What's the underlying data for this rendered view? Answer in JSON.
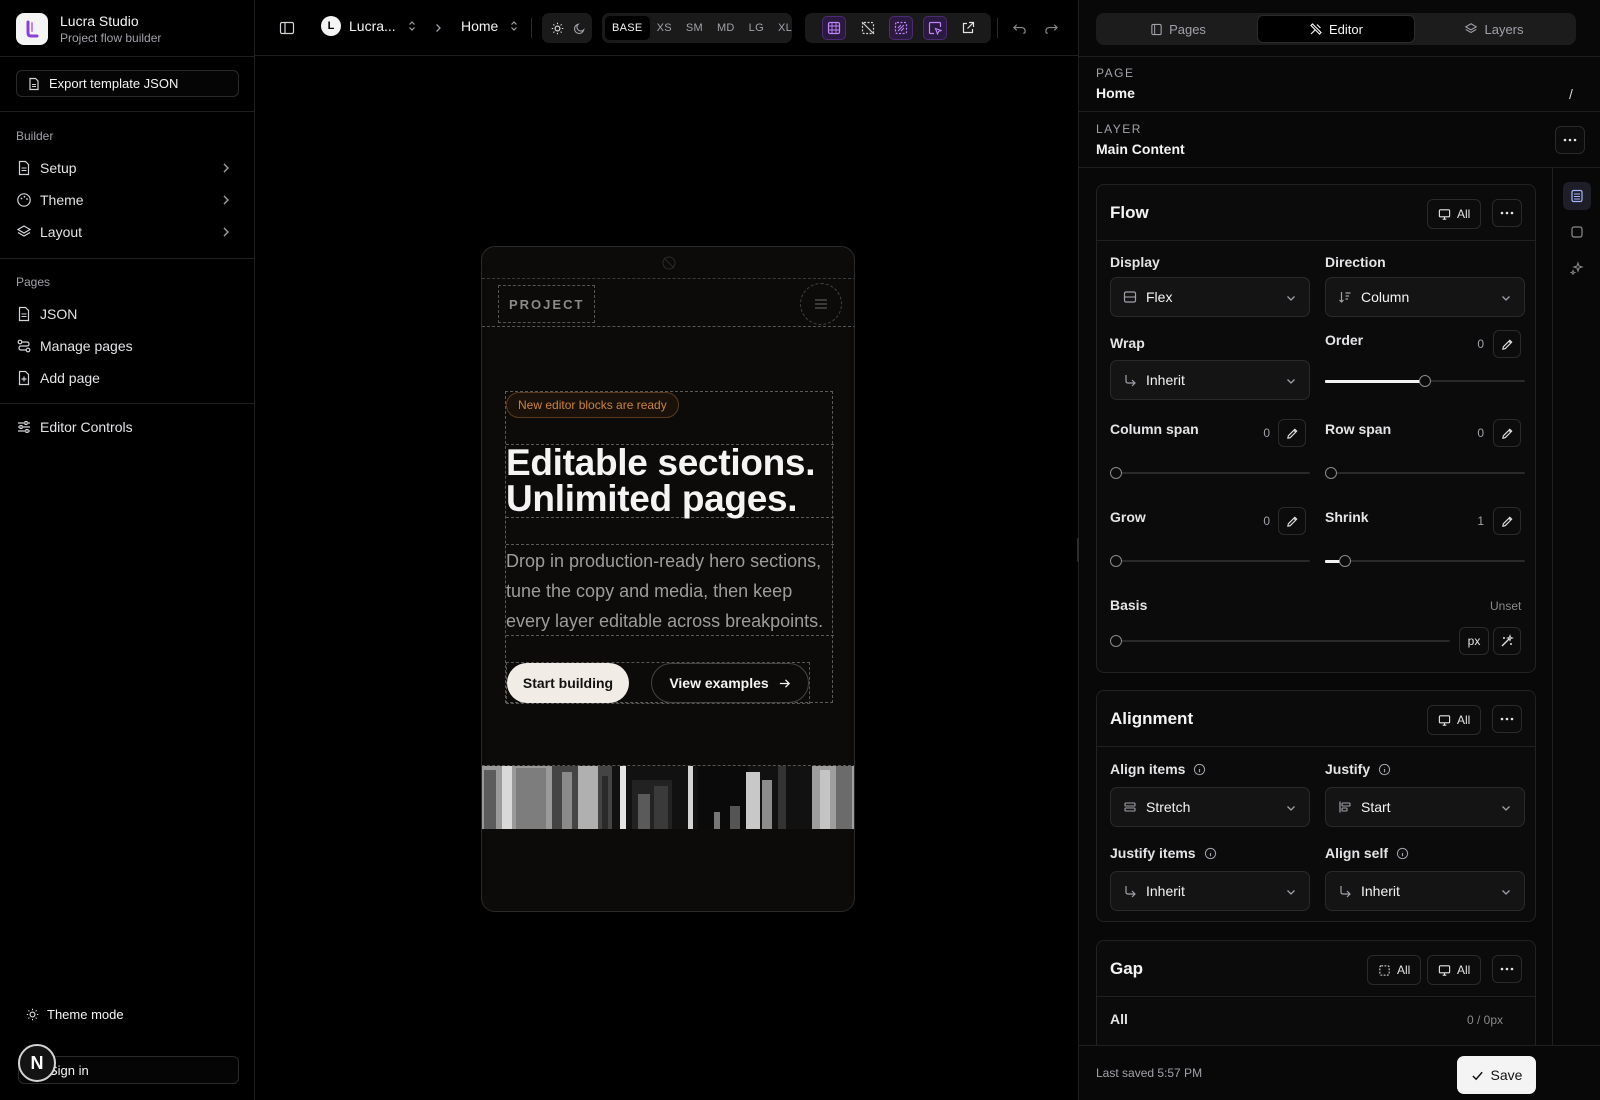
{
  "brand": {
    "name": "Lucra Studio",
    "subtitle": "Project flow builder"
  },
  "sidebar": {
    "export_label": "Export template JSON",
    "builder_label": "Builder",
    "builder_items": [
      {
        "label": "Setup",
        "icon": "document-icon"
      },
      {
        "label": "Theme",
        "icon": "palette-icon"
      },
      {
        "label": "Layout",
        "icon": "layers-icon"
      }
    ],
    "pages_label": "Pages",
    "pages_items": [
      {
        "label": "JSON",
        "icon": "document-icon"
      },
      {
        "label": "Manage pages",
        "icon": "route-icon"
      },
      {
        "label": "Add page",
        "icon": "add-page-icon"
      }
    ],
    "editor_controls_label": "Editor Controls",
    "theme_mode_label": "Theme mode",
    "signin_label": "Sign in",
    "avatar_letter": "N"
  },
  "toolbar": {
    "project_initial": "L",
    "project_name": "Lucra...",
    "page_name": "Home",
    "breakpoints": [
      "BASE",
      "XS",
      "SM",
      "MD",
      "LG",
      "XL"
    ],
    "active_breakpoint": "BASE"
  },
  "canvas": {
    "nav_tag": "PROJECT",
    "badge": "New editor blocks are ready",
    "headline_line1": "Editable sections.",
    "headline_line2": "Unlimited pages.",
    "subcopy": "Drop in production-ready hero sections, tune the copy and media, then keep every layer editable across breakpoints.",
    "primary_cta": "Start building",
    "secondary_cta": "View examples"
  },
  "panel": {
    "tabs": [
      {
        "label": "Pages",
        "active": false
      },
      {
        "label": "Editor",
        "active": true
      },
      {
        "label": "Layers",
        "active": false
      }
    ],
    "page_label": "PAGE",
    "page_value": "Home",
    "page_path": "/",
    "layer_label": "LAYER",
    "layer_value": "Main Content",
    "flow": {
      "title": "Flow",
      "scope": "All",
      "display_label": "Display",
      "display_value": "Flex",
      "direction_label": "Direction",
      "direction_value": "Column",
      "wrap_label": "Wrap",
      "wrap_value": "Inherit",
      "order_label": "Order",
      "order_value": "0",
      "order_level": 0.5,
      "column_span_label": "Column span",
      "column_span_value": "0",
      "row_span_label": "Row span",
      "row_span_value": "0",
      "grow_label": "Grow",
      "grow_value": "0",
      "shrink_label": "Shrink",
      "shrink_value": "1",
      "shrink_level": 0.1,
      "basis_label": "Basis",
      "basis_value": "Unset",
      "basis_unit": "px"
    },
    "alignment": {
      "title": "Alignment",
      "scope": "All",
      "align_items_label": "Align items",
      "align_items_value": "Stretch",
      "justify_label": "Justify",
      "justify_value": "Start",
      "justify_items_label": "Justify items",
      "justify_items_value": "Inherit",
      "align_self_label": "Align self",
      "align_self_value": "Inherit"
    },
    "gap": {
      "title": "Gap",
      "scope_a": "All",
      "scope_b": "All",
      "all_label": "All",
      "all_value": "0 / 0px"
    },
    "last_saved": "Last saved 5:57 PM",
    "save_label": "Save"
  },
  "colors": {
    "accent": "#a855f7",
    "badge_text": "#c9843f",
    "primary_cta_bg": "#f1ede6"
  }
}
